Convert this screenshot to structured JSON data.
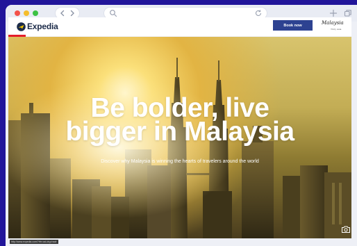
{
  "browser": {
    "icons": [
      "chevron-left-icon",
      "chevron-right-icon",
      "search-icon",
      "reload-icon",
      "plus-icon",
      "tabs-icon"
    ],
    "status_url": "http://www.expedia.com/?rfrr=ad-drg=hadr"
  },
  "site": {
    "brand": "Expedia",
    "book_button": "Book now",
    "partner_logo": "Malaysia",
    "partner_logo_sub": "Truly Asia",
    "accent_color": "#2d4291",
    "progress_color": "#e41d2b"
  },
  "hero": {
    "title_line1": "Be bolder, live",
    "title_line2": "bigger in Malaysia",
    "subtitle": "Discover why Malaysia is winning the hearts of travelers around the world",
    "icons": [
      "camera-icon"
    ]
  }
}
